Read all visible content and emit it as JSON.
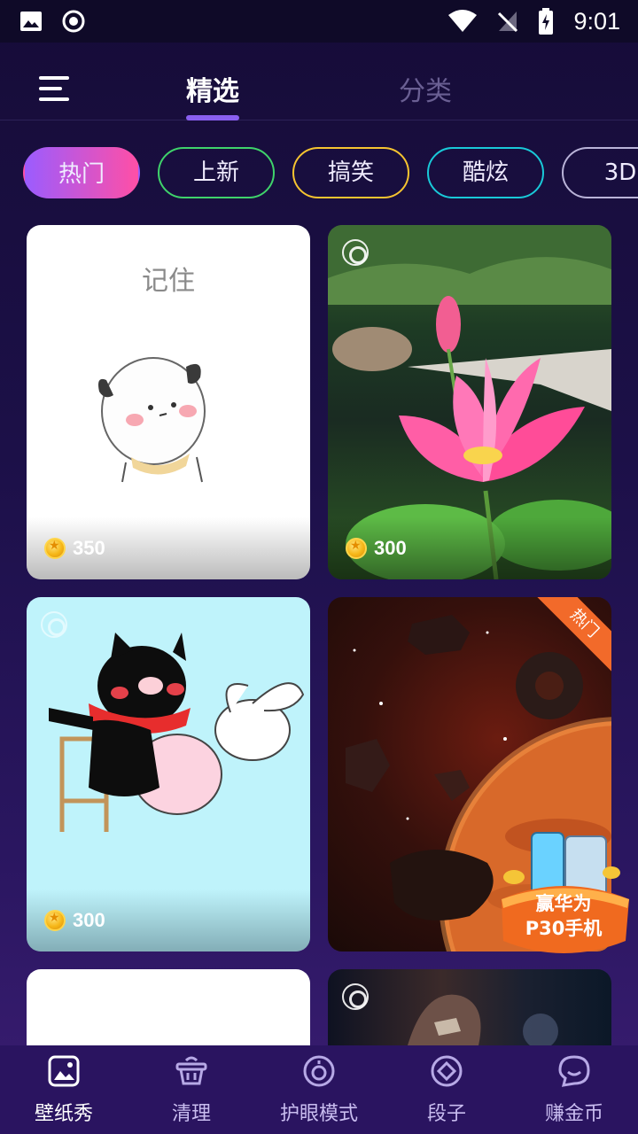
{
  "status_bar": {
    "time": "9:01"
  },
  "header": {
    "tabs": [
      {
        "label": "精选",
        "selected": true
      },
      {
        "label": "分类",
        "selected": false
      }
    ]
  },
  "chips": [
    {
      "label": "热门",
      "active": true,
      "color": "#ff4fa6"
    },
    {
      "label": "上新",
      "active": false,
      "color": "#3fd36b"
    },
    {
      "label": "搞笑",
      "active": false,
      "color": "#f6c430"
    },
    {
      "label": "酷炫",
      "active": false,
      "color": "#19c9d8"
    },
    {
      "label": "3D",
      "active": false,
      "color": "#b9b3d8"
    }
  ],
  "cards": [
    {
      "caption": "记住",
      "price": "350",
      "live": false,
      "hot": false
    },
    {
      "price": "300",
      "live": true,
      "hot": false
    },
    {
      "price": "300",
      "live": true,
      "hot": false
    },
    {
      "price": "",
      "live": false,
      "hot": true,
      "hot_label": "热门"
    },
    {
      "price": "",
      "live": false,
      "hot": false
    },
    {
      "price": "",
      "live": true,
      "hot": false
    }
  ],
  "promo": {
    "line1": "赢华为",
    "line2": "P30手机"
  },
  "bottom_nav": [
    {
      "label": "壁纸秀",
      "icon": "wallpaper-icon",
      "active": true
    },
    {
      "label": "清理",
      "icon": "broom-basket-icon",
      "active": false
    },
    {
      "label": "护眼模式",
      "icon": "eye-protect-icon",
      "active": false
    },
    {
      "label": "段子",
      "icon": "diamond-icon",
      "active": false
    },
    {
      "label": "赚金币",
      "icon": "chat-bubble-icon",
      "active": false
    }
  ]
}
